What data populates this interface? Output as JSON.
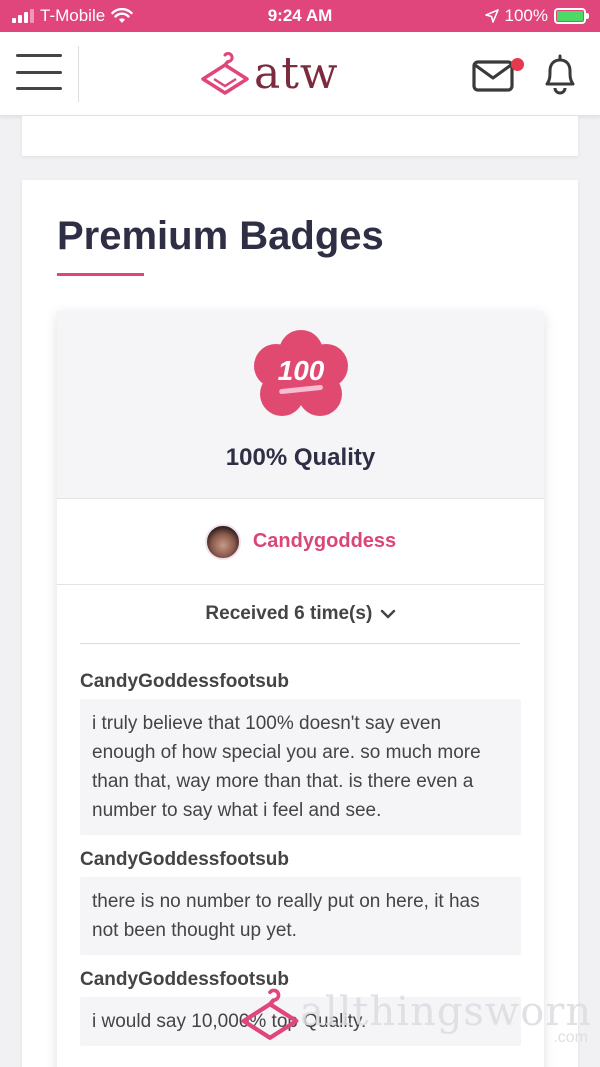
{
  "status_bar": {
    "carrier": "T-Mobile",
    "time": "9:24 AM",
    "battery": "100%"
  },
  "header": {
    "logo_text": "atw",
    "brand_color": "#e0457b",
    "has_unread_mail": true
  },
  "section": {
    "title": "Premium Badges"
  },
  "badge": {
    "icon_text": "100",
    "name": "100% Quality",
    "giver_name": "Candygoddess",
    "received_label": "Received 6 time(s)"
  },
  "comments": [
    {
      "author": "CandyGoddessfootsub",
      "text": "i truly believe that 100% doesn't say even enough of how special you are. so much more than that, way more than that. is there even a number to say what i feel and see."
    },
    {
      "author": "CandyGoddessfootsub",
      "text": "there is no number to really put on here, it has not been thought up yet."
    },
    {
      "author": "CandyGoddessfootsub",
      "text": "i would say 10,000% top Quality."
    }
  ],
  "watermark": {
    "text": "allthingsworn",
    "suffix": ".com"
  }
}
